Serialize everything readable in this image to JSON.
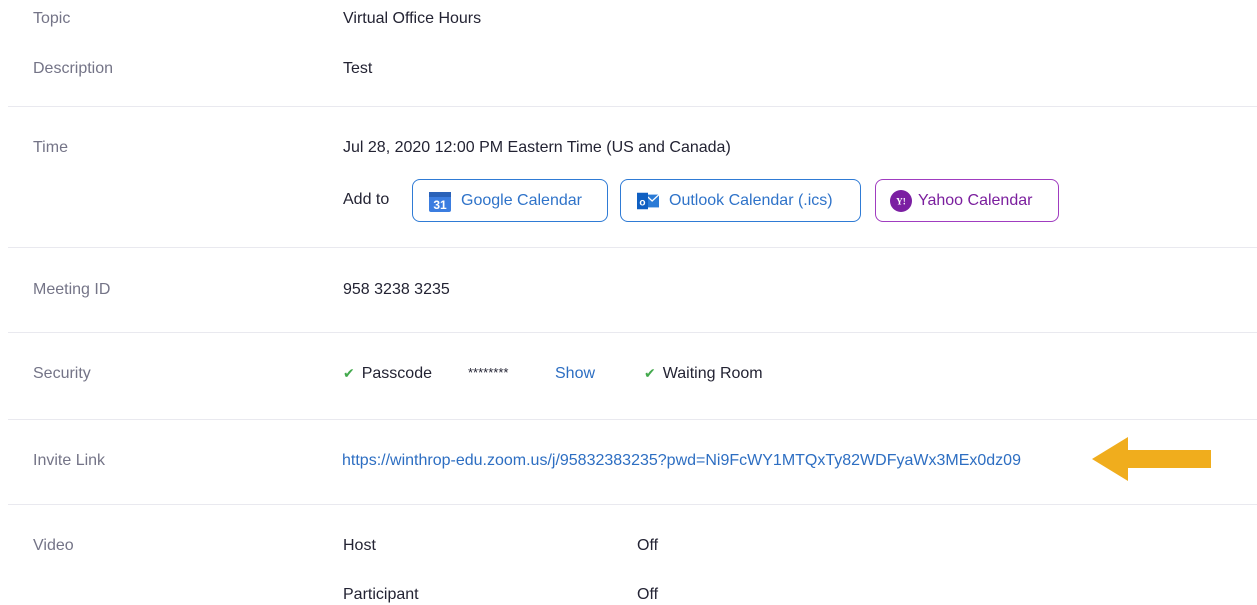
{
  "topic": {
    "label": "Topic",
    "value": "Virtual Office Hours"
  },
  "description": {
    "label": "Description",
    "value": "Test"
  },
  "time": {
    "label": "Time",
    "value": "Jul 28, 2020 12:00 PM Eastern Time (US and Canada)",
    "add_to": "Add to",
    "google": {
      "label": "Google Calendar",
      "icon_text": "31",
      "icon": "google-calendar-icon"
    },
    "outlook": {
      "label": "Outlook Calendar (.ics)",
      "icon_text": "o",
      "icon": "outlook-icon"
    },
    "yahoo": {
      "label": "Yahoo Calendar",
      "icon_text": "Y!",
      "icon": "yahoo-icon"
    }
  },
  "meeting_id": {
    "label": "Meeting ID",
    "value": "958 3238 3235"
  },
  "security": {
    "label": "Security",
    "passcode_label": "Passcode",
    "passcode_masked": "********",
    "show_label": "Show",
    "waiting_room_label": "Waiting Room",
    "check_color": "#43a94d"
  },
  "invite": {
    "label": "Invite Link",
    "url": "https://winthrop-edu.zoom.us/j/95832383235?pwd=Ni9FcWY1MTQxTy82WDFyaWx3MEx0dz09",
    "arrow_color": "#f0ad1d"
  },
  "video": {
    "label": "Video",
    "host_label": "Host",
    "host_value": "Off",
    "participant_label": "Participant",
    "participant_value": "Off"
  }
}
